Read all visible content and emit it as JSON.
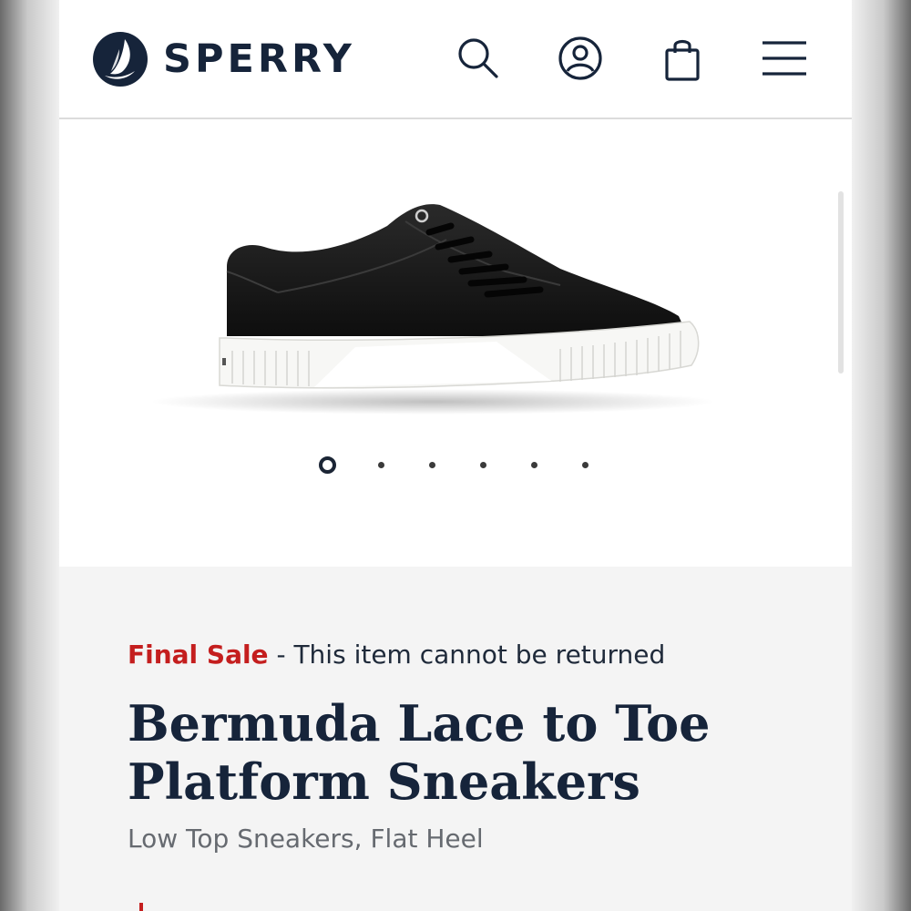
{
  "brand": {
    "name": "SPERRY",
    "logo_icon": "sailboat-logo-icon"
  },
  "header": {
    "icons": [
      "search-icon",
      "account-icon",
      "shopping-bag-icon",
      "menu-icon"
    ]
  },
  "gallery": {
    "image_alt": "black low-top platform sneaker",
    "slide_count": 6,
    "active_slide": 1
  },
  "product": {
    "sale_label": "Final Sale",
    "sale_note": " - This item cannot be returned",
    "title": "Bermuda Lace to Toe Platform Sneakers",
    "subtitle": "Low Top Sneakers, Flat Heel"
  },
  "colors": {
    "navy": "#16243a",
    "sale_red": "#c41e1e",
    "info_bg": "#f4f4f4"
  }
}
